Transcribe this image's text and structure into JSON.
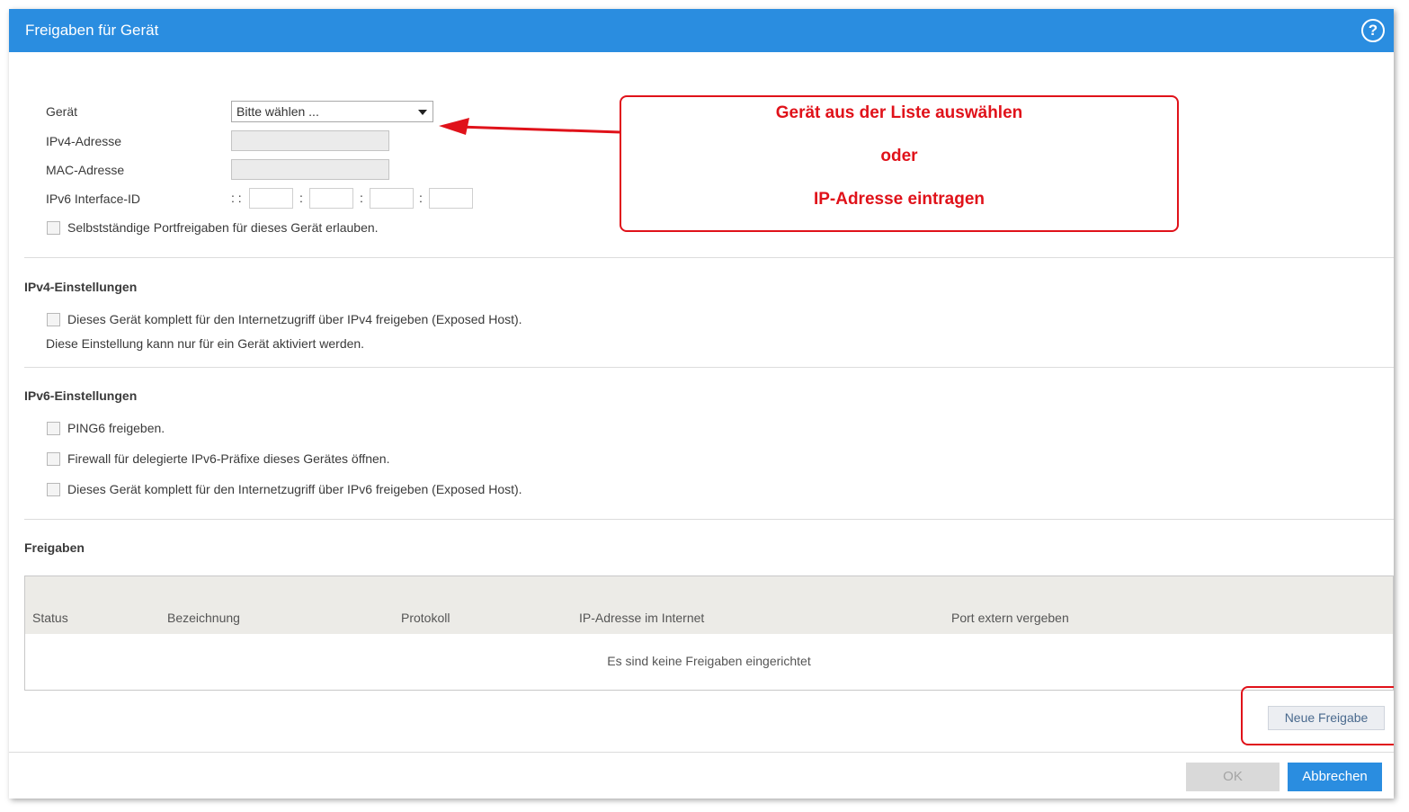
{
  "dialog": {
    "title": "Freigaben für Gerät",
    "help_symbol": "?"
  },
  "device": {
    "device_label": "Gerät",
    "device_select_value": "Bitte wählen ...",
    "ipv4_label": "IPv4-Adresse",
    "ipv4_value": "",
    "mac_label": "MAC-Adresse",
    "mac_value": "",
    "ipv6_label": "IPv6 Interface-ID",
    "ipv6_prefix": ": :",
    "ipv6_separator": ":",
    "allow_portfwd_label": "Selbstständige Portfreigaben für dieses Gerät erlauben.",
    "allow_portfwd_checked": false
  },
  "ipv4_settings": {
    "title": "IPv4-Einstellungen",
    "exposed_host_label": "Dieses Gerät komplett für den Internetzugriff über IPv4 freigeben (Exposed Host).",
    "exposed_host_checked": false,
    "note": "Diese Einstellung kann nur für ein Gerät aktiviert werden."
  },
  "ipv6_settings": {
    "title": "IPv6-Einstellungen",
    "ping6_label": "PING6 freigeben.",
    "ping6_checked": false,
    "firewall_label": "Firewall für delegierte IPv6-Präfixe dieses Gerätes öffnen.",
    "firewall_checked": false,
    "exposed_host_label": "Dieses Gerät komplett für den Internetzugriff über IPv6 freigeben (Exposed Host).",
    "exposed_host_checked": false
  },
  "shares": {
    "title": "Freigaben",
    "columns": [
      "Status",
      "Bezeichnung",
      "Protokoll",
      "IP-Adresse im Internet",
      "Port extern vergeben"
    ],
    "empty_message": "Es sind keine Freigaben eingerichtet",
    "new_button": "Neue Freigabe"
  },
  "footer": {
    "ok_label": "OK",
    "cancel_label": "Abbrechen"
  },
  "annotation": {
    "line1": "Gerät aus der Liste auswählen",
    "line2": "oder",
    "line3": "IP-Adresse eintragen"
  },
  "colors": {
    "titlebar": "#2a8de0",
    "primary_button": "#2a8de0",
    "annotation_red": "#e0121a"
  }
}
